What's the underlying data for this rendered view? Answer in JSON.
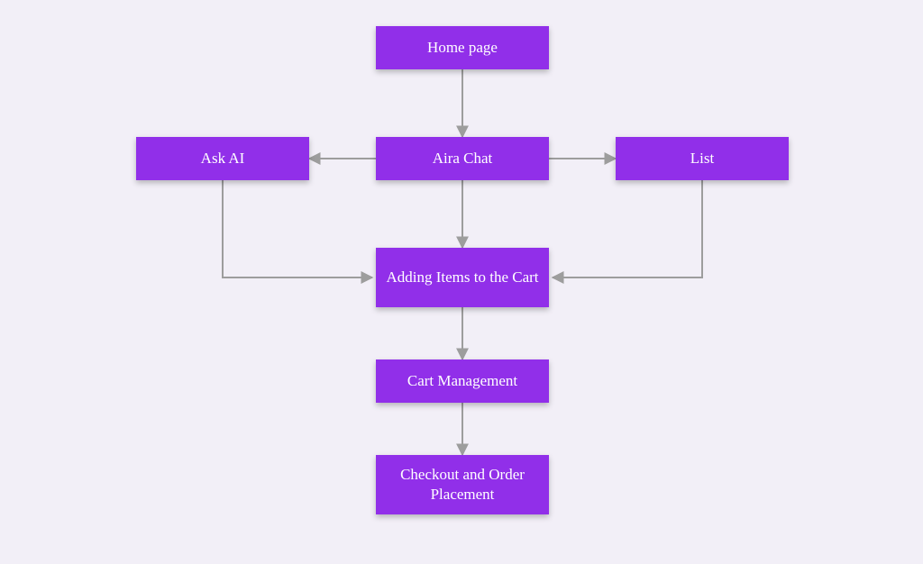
{
  "nodes": {
    "home": {
      "label": "Home page"
    },
    "askai": {
      "label": "Ask AI"
    },
    "airachat": {
      "label": "Aira Chat"
    },
    "list": {
      "label": "List"
    },
    "addcart": {
      "label": "Adding Items to the Cart"
    },
    "cartmgmt": {
      "label": "Cart Management"
    },
    "checkout": {
      "label": "Checkout and Order Placement"
    }
  },
  "edges": [
    {
      "from": "home",
      "to": "airachat"
    },
    {
      "from": "airachat",
      "to": "askai"
    },
    {
      "from": "airachat",
      "to": "list"
    },
    {
      "from": "askai",
      "to": "addcart"
    },
    {
      "from": "list",
      "to": "addcart"
    },
    {
      "from": "airachat",
      "to": "addcart"
    },
    {
      "from": "addcart",
      "to": "cartmgmt"
    },
    {
      "from": "cartmgmt",
      "to": "checkout"
    }
  ],
  "colors": {
    "node_bg": "#912fe9",
    "node_text": "#ffffff",
    "canvas_bg": "#f2eff7",
    "edge": "#9d9d9d"
  }
}
